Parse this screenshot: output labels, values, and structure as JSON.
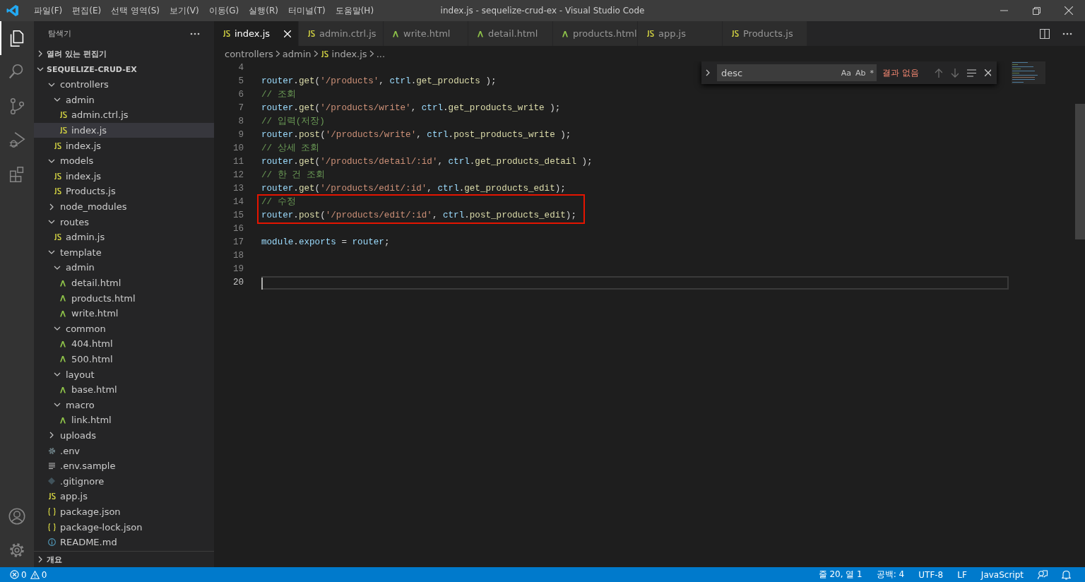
{
  "window": {
    "title": "index.js - sequelize-crud-ex - Visual Studio Code"
  },
  "menu": [
    "파일(F)",
    "편집(E)",
    "선택 영역(S)",
    "보기(V)",
    "이동(G)",
    "실행(R)",
    "터미널(T)",
    "도움말(H)"
  ],
  "activity_bar": {
    "top": [
      {
        "kind": "explorer",
        "selected": true
      },
      {
        "kind": "search",
        "selected": false
      },
      {
        "kind": "scm",
        "selected": false
      },
      {
        "kind": "debug",
        "selected": false
      },
      {
        "kind": "extensions",
        "selected": false
      }
    ],
    "bottom": [
      {
        "kind": "account",
        "selected": false
      },
      {
        "kind": "settings",
        "selected": false
      }
    ]
  },
  "sidebar": {
    "title": "탐색기",
    "open_editors": {
      "label": "열려 있는 편집기",
      "expanded": false
    },
    "project": {
      "label": "SEQUELIZE-CRUD-EX",
      "expanded": true
    },
    "tree": [
      {
        "name": "controllers",
        "kind": "folder",
        "expanded": true,
        "selected": false,
        "children": [
          {
            "name": "admin",
            "kind": "folder",
            "expanded": true,
            "selected": false,
            "children": [
              {
                "name": "admin.ctrl.js",
                "kind": "js",
                "selected": false
              },
              {
                "name": "index.js",
                "kind": "js",
                "selected": true
              }
            ]
          },
          {
            "name": "index.js",
            "kind": "js",
            "selected": false
          }
        ]
      },
      {
        "name": "models",
        "kind": "folder",
        "expanded": true,
        "selected": false,
        "children": [
          {
            "name": "index.js",
            "kind": "js",
            "selected": false
          },
          {
            "name": "Products.js",
            "kind": "js",
            "selected": false
          }
        ]
      },
      {
        "name": "node_modules",
        "kind": "folder",
        "expanded": false,
        "selected": false
      },
      {
        "name": "routes",
        "kind": "folder",
        "expanded": true,
        "selected": false,
        "children": [
          {
            "name": "admin.js",
            "kind": "js",
            "selected": false
          }
        ]
      },
      {
        "name": "template",
        "kind": "folder",
        "expanded": true,
        "selected": false,
        "children": [
          {
            "name": "admin",
            "kind": "folder",
            "expanded": true,
            "selected": false,
            "children": [
              {
                "name": "detail.html",
                "kind": "html",
                "selected": false
              },
              {
                "name": "products.html",
                "kind": "html",
                "selected": false
              },
              {
                "name": "write.html",
                "kind": "html",
                "selected": false
              }
            ]
          },
          {
            "name": "common",
            "kind": "folder",
            "expanded": true,
            "selected": false,
            "children": [
              {
                "name": "404.html",
                "kind": "html",
                "selected": false
              },
              {
                "name": "500.html",
                "kind": "html",
                "selected": false
              }
            ]
          },
          {
            "name": "layout",
            "kind": "folder",
            "expanded": true,
            "selected": false,
            "children": [
              {
                "name": "base.html",
                "kind": "html",
                "selected": false
              }
            ]
          },
          {
            "name": "macro",
            "kind": "folder",
            "expanded": true,
            "selected": false,
            "children": [
              {
                "name": "link.html",
                "kind": "html",
                "selected": false
              }
            ]
          }
        ]
      },
      {
        "name": "uploads",
        "kind": "folder",
        "expanded": false,
        "selected": false
      },
      {
        "name": ".env",
        "kind": "gear",
        "selected": false
      },
      {
        "name": ".env.sample",
        "kind": "lines",
        "selected": false
      },
      {
        "name": ".gitignore",
        "kind": "git",
        "selected": false
      },
      {
        "name": "app.js",
        "kind": "js",
        "selected": false
      },
      {
        "name": "package.json",
        "kind": "braces",
        "selected": false
      },
      {
        "name": "package-lock.json",
        "kind": "braces",
        "selected": false
      },
      {
        "name": "README.md",
        "kind": "info",
        "selected": false
      }
    ],
    "outline": {
      "label": "개요",
      "expanded": false
    }
  },
  "tabs": [
    {
      "label": "index.js",
      "kind": "js",
      "selected": true
    },
    {
      "label": "admin.ctrl.js",
      "kind": "js",
      "selected": false
    },
    {
      "label": "write.html",
      "kind": "html",
      "selected": false
    },
    {
      "label": "detail.html",
      "kind": "html",
      "selected": false
    },
    {
      "label": "products.html",
      "kind": "html",
      "selected": false
    },
    {
      "label": "app.js",
      "kind": "js",
      "selected": false
    },
    {
      "label": "Products.js",
      "kind": "js",
      "selected": false
    }
  ],
  "breadcrumb": [
    {
      "label": "controllers",
      "kind": "folder"
    },
    {
      "label": "admin",
      "kind": "folder"
    },
    {
      "label": "index.js",
      "kind": "js"
    },
    {
      "label": "...",
      "kind": "symbol"
    }
  ],
  "find": {
    "value": "desc",
    "options": [
      "Aa",
      "Ab",
      "*"
    ],
    "result": "결과 없음",
    "expanded": false
  },
  "code": [
    {
      "number": "4",
      "boxed": false,
      "current": false
    },
    {
      "number": "5",
      "boxed": false,
      "current": false,
      "tokens": [
        {
          "kind": "var",
          "text": "router"
        },
        {
          "kind": "punc",
          "text": "."
        },
        {
          "kind": "fn",
          "text": "get"
        },
        {
          "kind": "punc",
          "text": "("
        },
        {
          "kind": "str",
          "text": "'/products'"
        },
        {
          "kind": "punc",
          "text": ", "
        },
        {
          "kind": "var",
          "text": "ctrl"
        },
        {
          "kind": "punc",
          "text": "."
        },
        {
          "kind": "fn",
          "text": "get_products"
        },
        {
          "kind": "punc",
          "text": " );"
        }
      ]
    },
    {
      "number": "6",
      "boxed": false,
      "current": false,
      "tokens": [
        {
          "kind": "comment",
          "text": "// 조회"
        }
      ]
    },
    {
      "number": "7",
      "boxed": false,
      "current": false,
      "tokens": [
        {
          "kind": "var",
          "text": "router"
        },
        {
          "kind": "punc",
          "text": "."
        },
        {
          "kind": "fn",
          "text": "get"
        },
        {
          "kind": "punc",
          "text": "("
        },
        {
          "kind": "str",
          "text": "'/products/write'"
        },
        {
          "kind": "punc",
          "text": ", "
        },
        {
          "kind": "var",
          "text": "ctrl"
        },
        {
          "kind": "punc",
          "text": "."
        },
        {
          "kind": "fn",
          "text": "get_products_write"
        },
        {
          "kind": "punc",
          "text": " );"
        }
      ]
    },
    {
      "number": "8",
      "boxed": false,
      "current": false,
      "tokens": [
        {
          "kind": "comment",
          "text": "// 입력(저장)"
        }
      ]
    },
    {
      "number": "9",
      "boxed": false,
      "current": false,
      "tokens": [
        {
          "kind": "var",
          "text": "router"
        },
        {
          "kind": "punc",
          "text": "."
        },
        {
          "kind": "fn",
          "text": "post"
        },
        {
          "kind": "punc",
          "text": "("
        },
        {
          "kind": "str",
          "text": "'/products/write'"
        },
        {
          "kind": "punc",
          "text": ", "
        },
        {
          "kind": "var",
          "text": "ctrl"
        },
        {
          "kind": "punc",
          "text": "."
        },
        {
          "kind": "fn",
          "text": "post_products_write"
        },
        {
          "kind": "punc",
          "text": " );"
        }
      ]
    },
    {
      "number": "10",
      "boxed": false,
      "current": false,
      "tokens": [
        {
          "kind": "comment",
          "text": "// 상세 조회"
        }
      ]
    },
    {
      "number": "11",
      "boxed": false,
      "current": false,
      "tokens": [
        {
          "kind": "var",
          "text": "router"
        },
        {
          "kind": "punc",
          "text": "."
        },
        {
          "kind": "fn",
          "text": "get"
        },
        {
          "kind": "punc",
          "text": "("
        },
        {
          "kind": "str",
          "text": "'/products/detail/:id'"
        },
        {
          "kind": "punc",
          "text": ", "
        },
        {
          "kind": "var",
          "text": "ctrl"
        },
        {
          "kind": "punc",
          "text": "."
        },
        {
          "kind": "fn",
          "text": "get_products_detail"
        },
        {
          "kind": "punc",
          "text": " );"
        }
      ]
    },
    {
      "number": "12",
      "boxed": false,
      "current": false,
      "tokens": [
        {
          "kind": "comment",
          "text": "// 한 건 조회"
        }
      ]
    },
    {
      "number": "13",
      "boxed": false,
      "current": false,
      "tokens": [
        {
          "kind": "var",
          "text": "router"
        },
        {
          "kind": "punc",
          "text": "."
        },
        {
          "kind": "fn",
          "text": "get"
        },
        {
          "kind": "punc",
          "text": "("
        },
        {
          "kind": "str",
          "text": "'/products/edit/:id'"
        },
        {
          "kind": "punc",
          "text": ", "
        },
        {
          "kind": "var",
          "text": "ctrl"
        },
        {
          "kind": "punc",
          "text": "."
        },
        {
          "kind": "fn",
          "text": "get_products_edit"
        },
        {
          "kind": "punc",
          "text": ");"
        }
      ]
    },
    {
      "number": "14",
      "boxed": true,
      "current": false,
      "tokens": [
        {
          "kind": "comment",
          "text": "// 수정"
        }
      ]
    },
    {
      "number": "15",
      "boxed": true,
      "current": false,
      "tokens": [
        {
          "kind": "var",
          "text": "router"
        },
        {
          "kind": "punc",
          "text": "."
        },
        {
          "kind": "fn",
          "text": "post"
        },
        {
          "kind": "punc",
          "text": "("
        },
        {
          "kind": "str",
          "text": "'/products/edit/:id'"
        },
        {
          "kind": "punc",
          "text": ", "
        },
        {
          "kind": "var",
          "text": "ctrl"
        },
        {
          "kind": "punc",
          "text": "."
        },
        {
          "kind": "fn",
          "text": "post_products_edit"
        },
        {
          "kind": "punc",
          "text": ");"
        }
      ]
    },
    {
      "number": "16",
      "boxed": false,
      "current": false
    },
    {
      "number": "17",
      "boxed": false,
      "current": false,
      "tokens": [
        {
          "kind": "var",
          "text": "module"
        },
        {
          "kind": "punc",
          "text": "."
        },
        {
          "kind": "var",
          "text": "exports"
        },
        {
          "kind": "punc",
          "text": " = "
        },
        {
          "kind": "var",
          "text": "router"
        },
        {
          "kind": "punc",
          "text": ";"
        }
      ]
    },
    {
      "number": "18",
      "boxed": false,
      "current": false
    },
    {
      "number": "19",
      "boxed": false,
      "current": false
    },
    {
      "number": "20",
      "boxed": false,
      "current": true
    }
  ],
  "status_bar": {
    "errors": "0",
    "warnings": "0",
    "items": [
      "줄 20, 열 1",
      "공백: 4",
      "UTF-8",
      "LF",
      "JavaScript"
    ]
  }
}
